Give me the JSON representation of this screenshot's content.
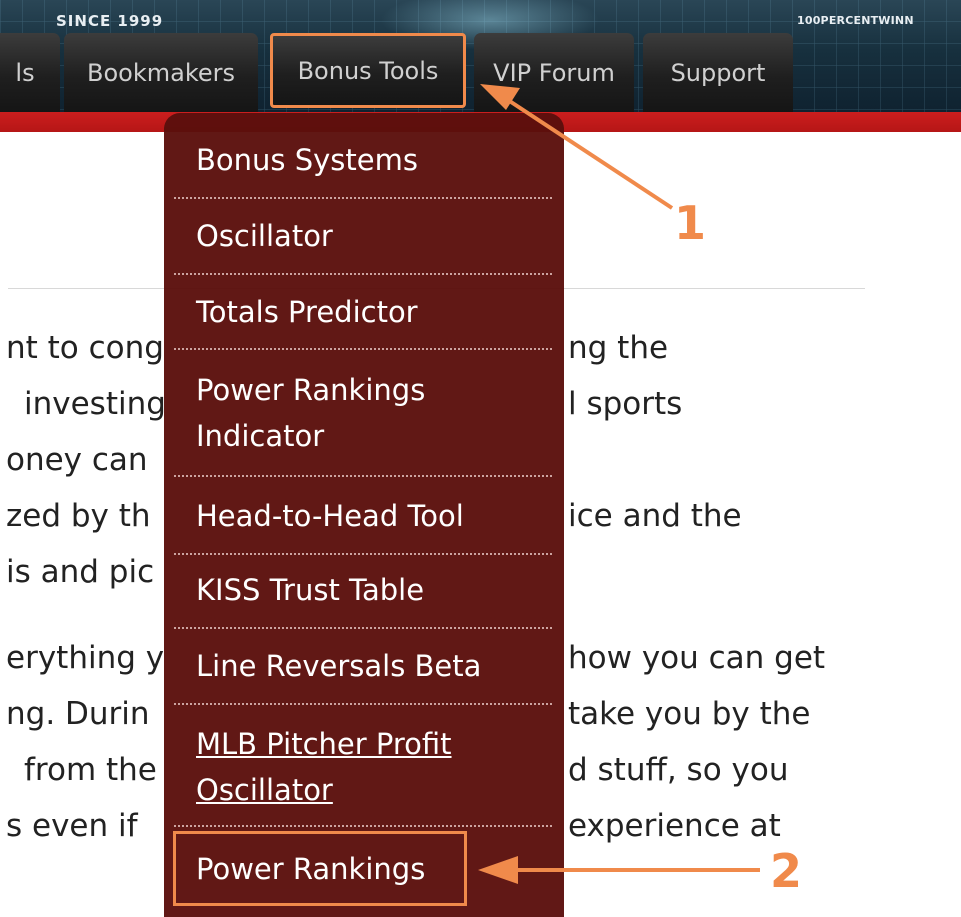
{
  "banner": {
    "since_text": "SINCE 1999",
    "site_text": "100PERCENTWINN"
  },
  "nav": {
    "tabs": [
      {
        "label": "ls"
      },
      {
        "label": "Bookmakers"
      },
      {
        "label": "Bonus Tools"
      },
      {
        "label": "VIP Forum"
      },
      {
        "label": "Support"
      }
    ]
  },
  "dropdown": {
    "items": [
      {
        "label": "Bonus Systems"
      },
      {
        "label": "Oscillator"
      },
      {
        "label": "Totals Predictor"
      },
      {
        "label": "Power Rankings Indicator"
      },
      {
        "label": "Head-to-Head Tool"
      },
      {
        "label": "KISS Trust Table"
      },
      {
        "label": "Line Reversals Beta"
      },
      {
        "label": "MLB Pitcher Profit Oscillator"
      },
      {
        "label": "Power Rankings"
      }
    ]
  },
  "body_text": {
    "left_lines": [
      "nt to cong",
      "investing",
      "oney can",
      "zed by th",
      "is and pic",
      "erything y",
      "ng. Durin",
      "from the",
      "s even if"
    ],
    "right_lines": [
      "ng the",
      "l sports",
      "ice and the",
      "how you can get",
      "take you by the",
      "d stuff, so you",
      "experience at"
    ]
  },
  "annotations": {
    "arrow1_label": "1",
    "arrow2_label": "2",
    "accent_color": "#f08a4b"
  },
  "colors": {
    "dropdown_bg": "#5b0f0c",
    "red_bar": "#c41a1a",
    "tab_bg": "#1f1f1f"
  }
}
